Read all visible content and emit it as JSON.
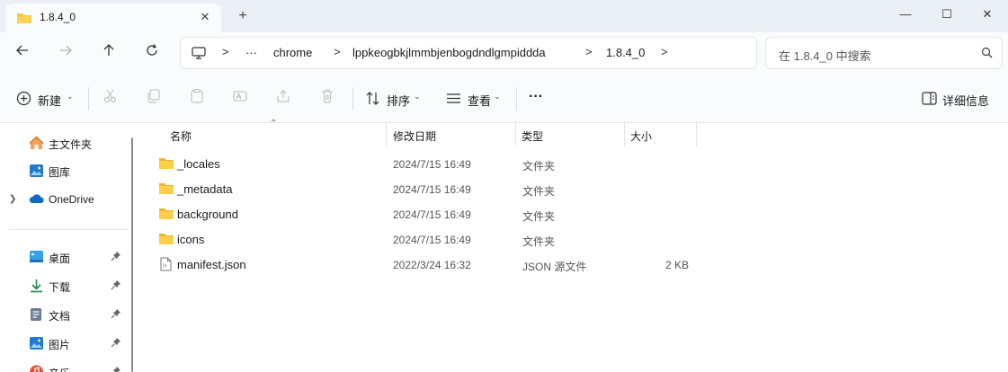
{
  "window": {
    "tab_title": "1.8.4_0",
    "tab_close": "✕",
    "new_tab": "+",
    "minimize": "—",
    "maximize": "☐",
    "close": "✕"
  },
  "address": {
    "overflow": "···",
    "breadcrumbs": [
      "chrome",
      "lppkeogbkjlmmbjenbogdndlgmpiddda",
      "1.8.4_0"
    ],
    "separator": ">"
  },
  "search": {
    "placeholder": "在 1.8.4_0 中搜索"
  },
  "toolbar": {
    "new_label": "新建",
    "sort_label": "排序",
    "view_label": "查看",
    "more_label": "···",
    "details_label": "详细信息"
  },
  "sidebar": {
    "items": [
      {
        "label": "主文件夹"
      },
      {
        "label": "图库"
      },
      {
        "label": "OneDrive"
      },
      {
        "label": "桌面"
      },
      {
        "label": "下载"
      },
      {
        "label": "文档"
      },
      {
        "label": "图片"
      },
      {
        "label": "音乐"
      }
    ]
  },
  "columns": {
    "name": "名称",
    "modified": "修改日期",
    "type": "类型",
    "size": "大小"
  },
  "files": [
    {
      "name": "_locales",
      "modified": "2024/7/15 16:49",
      "type": "文件夹",
      "size": "",
      "kind": "folder"
    },
    {
      "name": "_metadata",
      "modified": "2024/7/15 16:49",
      "type": "文件夹",
      "size": "",
      "kind": "folder"
    },
    {
      "name": "background",
      "modified": "2024/7/15 16:49",
      "type": "文件夹",
      "size": "",
      "kind": "folder"
    },
    {
      "name": "icons",
      "modified": "2024/7/15 16:49",
      "type": "文件夹",
      "size": "",
      "kind": "folder"
    },
    {
      "name": "manifest.json",
      "modified": "2022/3/24 16:32",
      "type": "JSON 源文件",
      "size": "2 KB",
      "kind": "file"
    }
  ],
  "colors": {
    "titlebar_bg": "#ebf0f6",
    "folder_yellow": "#f8c33c",
    "accent_blue": "#0f6cbd"
  }
}
